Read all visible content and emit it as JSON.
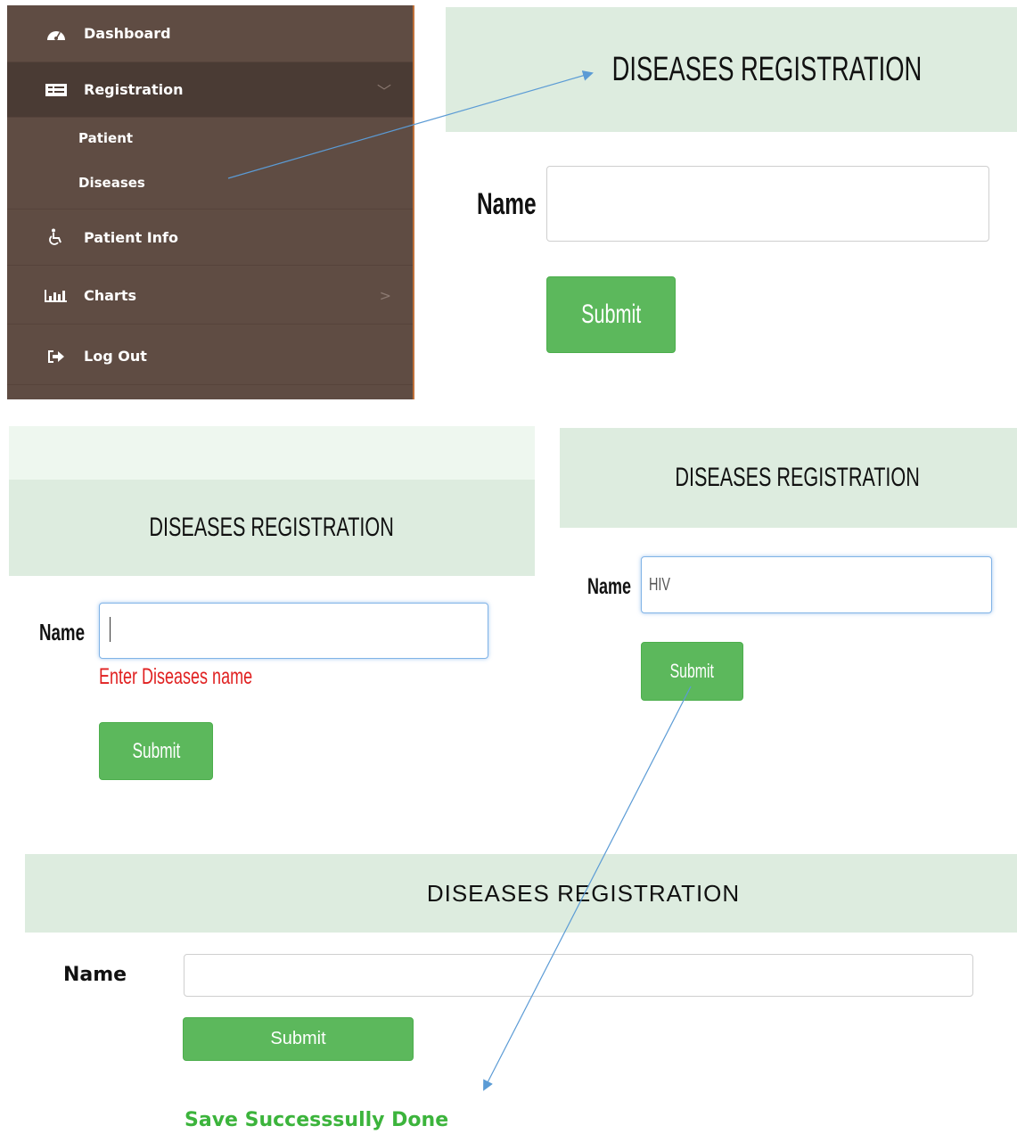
{
  "sidebar": {
    "items": [
      {
        "label": "Dashboard",
        "icon": "dashboard-icon"
      },
      {
        "label": "Registration",
        "icon": "registration-icon",
        "chevron": "﹀"
      },
      {
        "label": "Patient Info",
        "icon": "wheelchair-icon"
      },
      {
        "label": "Charts",
        "icon": "bar-chart-icon",
        "chevron": ">"
      },
      {
        "label": "Log Out",
        "icon": "logout-icon"
      }
    ],
    "sub_items": [
      "Patient",
      "Diseases"
    ]
  },
  "panel1": {
    "title": "DISEASES REGISTRATION",
    "name_label": "Name",
    "name_value": "",
    "submit": "Submit"
  },
  "panel2": {
    "title": "DISEASES REGISTRATION",
    "name_label": "Name",
    "name_value": "",
    "error": "Enter Diseases name",
    "submit": "Submit"
  },
  "panel3": {
    "title": "DISEASES REGISTRATION",
    "name_label": "Name",
    "name_value": "HIV",
    "submit": "Submit"
  },
  "panel4": {
    "title": "DISEASES REGISTRATION",
    "name_label": "Name",
    "name_value": "",
    "submit": "Submit",
    "success": "Save Successsully Done"
  },
  "colors": {
    "sidebar": "#5f4c43",
    "header": "#ddecdf",
    "button": "#5cb85c",
    "error": "#e02020",
    "success": "#3cb43c",
    "arrow": "#5b9bd5"
  }
}
